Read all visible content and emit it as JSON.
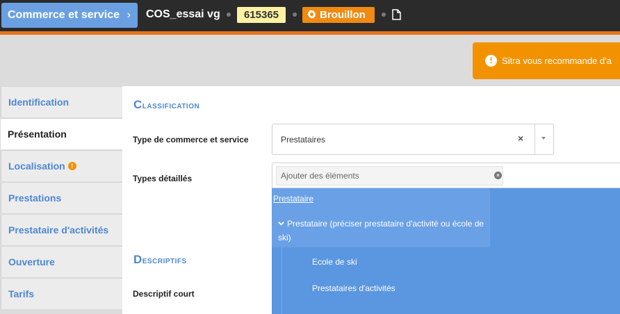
{
  "header": {
    "breadcrumb": "Commerce et service",
    "chevron": "›",
    "title": "COS_essai vg",
    "id": "615365",
    "status": "Brouillon",
    "status_icon": "gear-icon",
    "file_icon": "file-icon",
    "accent_color": "#e8731c"
  },
  "alert": {
    "text": "Sitra vous recommande d'a",
    "icon": "!"
  },
  "sidebar": {
    "items": [
      {
        "label": "Identification"
      },
      {
        "label": "Présentation"
      },
      {
        "label": "Localisation",
        "warning": "!"
      },
      {
        "label": "Prestations"
      },
      {
        "label": "Prestataire d'activités"
      },
      {
        "label": "Ouverture"
      },
      {
        "label": "Tarifs"
      }
    ],
    "active_index": 1
  },
  "main": {
    "classification": {
      "title_cap": "C",
      "title_rest": "lassification",
      "type_label": "Type de commerce et service",
      "type_value": "Prestataires",
      "type_clear": "×",
      "detailed_label": "Types détaillés",
      "detailed_placeholder": "Ajouter des éléments",
      "detailed_clear": "×"
    },
    "dropdown": {
      "group_link": "Prestataire",
      "parent": "Prestataire (préciser prestataire d'activité ou école de ski)",
      "children": [
        "Ecole de ski",
        "Prestataires d'activités"
      ]
    },
    "descriptifs": {
      "title_cap": "D",
      "title_rest": "escriptifs",
      "short_label": "Descriptif court"
    }
  }
}
